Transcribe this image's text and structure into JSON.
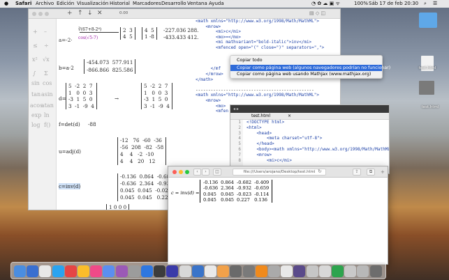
{
  "menubar": {
    "apple": "",
    "app": "Safari",
    "items": [
      "Archivo",
      "Edición",
      "Visualización",
      "Historial",
      "Marcadores",
      "Desarrollo",
      "Ventana",
      "Ayuda"
    ],
    "battery": "100%",
    "clock": "Sáb 17 de feb  20:30"
  },
  "math_window": {
    "toolbar": {
      "add": "+",
      "up": "↑",
      "down": "↓",
      "close": "✕",
      "counter": "0.00"
    },
    "palette": [
      "≤",
      "+",
      "–",
      "÷",
      "x²",
      "√x",
      "∫",
      "Σ",
      "sin",
      "cos",
      "tan",
      "asin",
      "acos",
      "atan",
      "exp",
      "ln",
      "log",
      "f()"
    ],
    "equations": [
      {
        "lhs": "a=-2·",
        "rhs_note": "cos(√5-7)"
      },
      {
        "lhs": "b=a·2",
        "rows": [
          "-454.073  577.911",
          "-866.866  825.586"
        ]
      },
      {
        "lhs": "d=",
        "left_rows": [
          "5  -2  2  7",
          "1   0  0  3",
          "-3  1  5  0",
          "3  -1  -9  4"
        ],
        "right_rows": [
          "5  -2  2  7",
          "1   0  0  3",
          "-3  1  5  0",
          "3  -1  -9  4"
        ]
      },
      {
        "lhs": "f=det(d)",
        "rhs": "-88"
      },
      {
        "lhs": "u=adj(d)",
        "rows": [
          "-12   76  -60  -36",
          "-56  208  -82  -58",
          "4    4   -2  -10",
          "4    4   20   12"
        ]
      },
      {
        "lhs": "c=inv(d)",
        "rows": [
          "-0.136  0.864  -0.682  -0.40",
          "-0.636  2.364  -0.932  -0.65",
          "0.045  0.045  -0.023  -0.11",
          "0.045  0.045   0.227   0.136"
        ]
      },
      {
        "lhs": "",
        "rows": [
          "1 0 0 0"
        ]
      }
    ],
    "result_top": [
      "-227.036 288.",
      "-433.433 412."
    ]
  },
  "code_lines": [
    "<math xmlns=\"http://www.w3.org/1998/Math/MathML\">",
    "    <mrow>",
    "        <mi>c</mi>",
    "        <mo>=</mo>",
    "        <mi mathvariant=\"bold-italic\">inv</mi>",
    "        <mfenced open=\"(\" close=\")\" separators=\",\">",
    "",
    "",
    "",
    "      </mf",
    "    </mrow>",
    "</math>",
    "",
    "-----------------------------------------------",
    "<math xmlns=\"http://www.w3.org/1998/Math/MathML\">",
    "    <mrow>",
    "        <mo>",
    "        <mfen"
  ],
  "context_menu": {
    "items": [
      "Copiar todo",
      "Copiar como página web (algunos navegadores podrían no funcionar)",
      "Copiar como página web usando MathJax (www.mathjax.org)"
    ],
    "highlighted": 1
  },
  "editor": {
    "tab": "test.html",
    "close": "×",
    "line_numbers": [
      "1",
      "2",
      "3",
      "4",
      "5",
      "6",
      "7",
      "8"
    ],
    "lines": [
      "<!DOCTYPE html>",
      "<html>",
      "    <head>",
      "        <meta charset=\"utf-8\">",
      "    </head>",
      "    <body><math xmlns=\"http://www.w3.org/1998/Math/MathML\">",
      "    <mrow>",
      "        <mi>c</mi>"
    ]
  },
  "browser": {
    "url": "file:///Users/arojano/Desktop/test.html",
    "equation_lhs": "c = inv(d) =",
    "matrix": [
      [
        "-0.136",
        "0.864",
        "-0.682",
        "-0.409"
      ],
      [
        "-0.636",
        "2.364",
        "-0.932",
        "-0.659"
      ],
      [
        "0.045",
        "0.045",
        "-0.023",
        "-0.114"
      ],
      [
        "0.045",
        "0.045",
        "0.227",
        "0.136"
      ]
    ]
  },
  "desktop": {
    "icons": [
      {
        "label": ""
      },
      {
        "label": "test.html"
      },
      {
        "label": ""
      },
      {
        "label": "test.html"
      }
    ]
  }
}
